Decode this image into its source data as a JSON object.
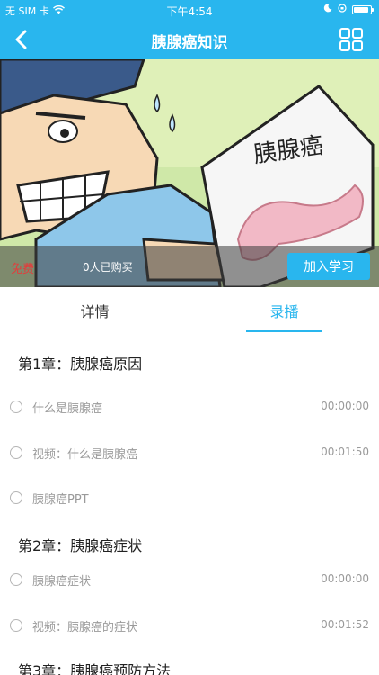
{
  "status_bar": {
    "carrier": "无 SIM 卡",
    "time": "下午4:54"
  },
  "nav": {
    "title": "胰腺癌知识",
    "back_icon": "chevron-left-icon",
    "menu_icon": "grid-icon"
  },
  "banner": {
    "illustration_text": "胰腺癌",
    "price_label": "免费",
    "purchase_count": "0人已购买",
    "join_label": "加入学习"
  },
  "tabs": [
    {
      "label": "详情",
      "active": false
    },
    {
      "label": "录播",
      "active": true
    }
  ],
  "chapters": [
    {
      "title": "第1章：胰腺癌原因",
      "items": [
        {
          "label": "什么是胰腺癌",
          "duration": "00:00:00"
        },
        {
          "label": "视频：什么是胰腺癌",
          "duration": "00:01:50"
        },
        {
          "label": "胰腺癌PPT",
          "duration": ""
        }
      ]
    },
    {
      "title": "第2章：胰腺癌症状",
      "items": [
        {
          "label": "胰腺癌症状",
          "duration": "00:00:00"
        },
        {
          "label": "视频：胰腺癌的症状",
          "duration": "00:01:52"
        }
      ]
    },
    {
      "title": "第3章：胰腺癌预防方法",
      "items": []
    }
  ],
  "colors": {
    "accent": "#29b6ee",
    "free_red": "#e63a3a"
  }
}
